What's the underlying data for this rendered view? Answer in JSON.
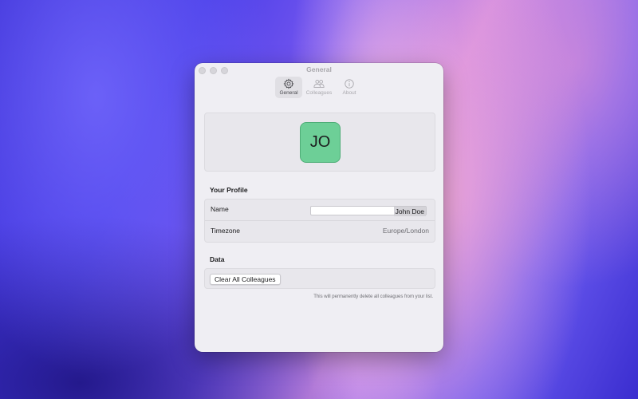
{
  "window": {
    "title": "General"
  },
  "toolbar": {
    "items": [
      {
        "label": "General",
        "icon": "gear-icon",
        "active": true
      },
      {
        "label": "Colleagues",
        "icon": "people-icon",
        "active": false
      },
      {
        "label": "About",
        "icon": "info-icon",
        "active": false
      }
    ]
  },
  "avatar": {
    "initials": "JO",
    "color": "#6dcf97"
  },
  "profile": {
    "section_title": "Your Profile",
    "name_label": "Name",
    "name_value": "John Doe",
    "timezone_label": "Timezone",
    "timezone_value": "Europe/London"
  },
  "data_section": {
    "section_title": "Data",
    "clear_button": "Clear All Colleagues",
    "hint": "This will permanently delete all colleagues from your list."
  }
}
